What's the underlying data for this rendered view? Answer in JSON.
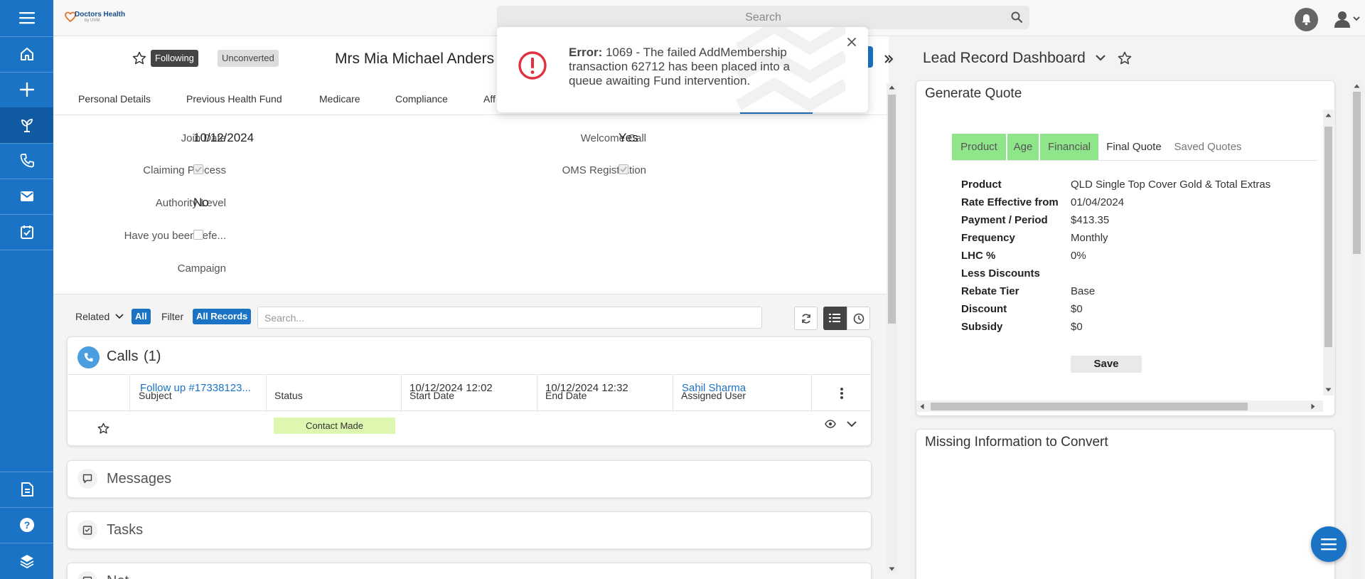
{
  "app": {
    "logo_text": "Doctors Health",
    "logo_sub": "by UVM"
  },
  "topbar": {
    "search_placeholder": "Search"
  },
  "record": {
    "following_label": "Following",
    "status_label": "Unconverted",
    "name": "Mrs Mia Michael Anders",
    "tabs": [
      "Personal Details",
      "Previous Health Fund",
      "Medicare",
      "Compliance",
      "Aff"
    ]
  },
  "fields": {
    "join_date_label": "Join Date",
    "join_date_value": "10/12/2024",
    "claiming_process_label": "Claiming Process",
    "authority_level_label": "Authority Level",
    "authority_level_value": "No",
    "referred_label": "Have you been refe...",
    "campaign_label": "Campaign",
    "welcome_call_label": "Welcome Call",
    "welcome_call_value": "Yes",
    "oms_registration_label": "OMS Registration"
  },
  "related_bar": {
    "related_label": "Related",
    "all_label": "All",
    "filter_label": "Filter",
    "all_records_label": "All Records",
    "search_placeholder": "Search..."
  },
  "calls": {
    "title": "Calls",
    "count": "(1)",
    "headers": [
      "Subject",
      "Status",
      "Start Date",
      "End Date",
      "Assigned User"
    ],
    "row": {
      "subject": "Follow up #17338123...",
      "status": "Contact Made",
      "start_date": "10/12/2024 12:02",
      "end_date": "10/12/2024 12:32",
      "assigned_user": "Sahil Sharma"
    }
  },
  "sections": {
    "messages": "Messages",
    "tasks": "Tasks",
    "partial": "Not"
  },
  "toast": {
    "prefix": "Error:",
    "line1": "1069 - The failed AddMembership",
    "line2": "transaction 62712 has been placed into a",
    "line3": "queue awaiting Fund intervention."
  },
  "dashboard": {
    "title": "Lead Record Dashboard",
    "quote_title": "Generate Quote",
    "quote_tabs": [
      "Product",
      "Age",
      "Financial",
      "Final Quote",
      "Saved Quotes"
    ],
    "quote_rows": [
      {
        "label": "Product",
        "value": "QLD Single Top Cover Gold & Total Extras"
      },
      {
        "label": "Rate Effective from",
        "value": "01/04/2024"
      },
      {
        "label": "Payment / Period",
        "value": "$413.35"
      },
      {
        "label": "Frequency",
        "value": "Monthly"
      },
      {
        "label": "LHC %",
        "value": "0%"
      },
      {
        "label": "Less Discounts",
        "value": ""
      },
      {
        "label": "Rebate Tier",
        "value": "Base"
      },
      {
        "label": "Discount",
        "value": "$0"
      },
      {
        "label": "Subsidy",
        "value": "$0"
      }
    ],
    "save_label": "Save",
    "missing_title": "Missing Information to Convert"
  },
  "colors": {
    "nav_blue": "#1a73c4",
    "completed_tab_green": "#8fe58a",
    "status_green": "#ddf7b0",
    "link_blue": "#1a73c4",
    "error_red": "#e0313f"
  }
}
